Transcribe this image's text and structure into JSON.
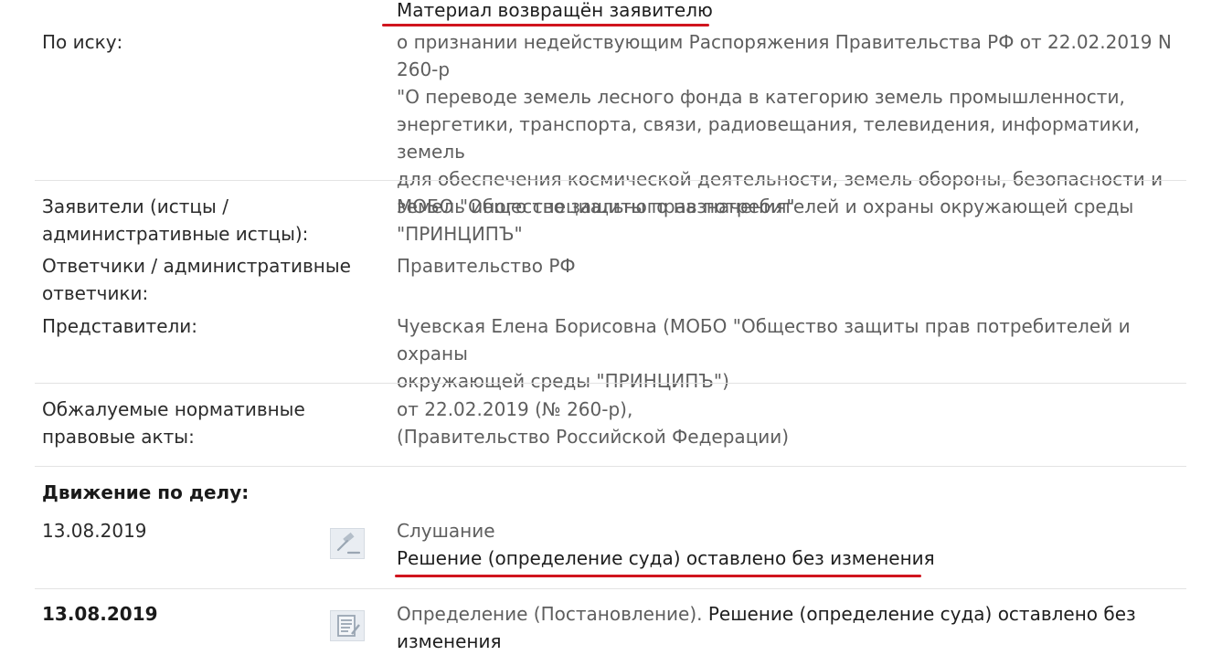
{
  "top": {
    "status_value": "Материал возвращён заявителю"
  },
  "claim": {
    "label": "По иску:",
    "lines": [
      "о признании недействующим Распоряжения Правительства РФ от 22.02.2019 N 260-р",
      "\"О переводе земель лесного фонда в категорию земель промышленности,",
      "энергетики, транспорта, связи, радиовещания, телевидения, информатики, земель",
      "для обеспечения космической деятельности, земель обороны, безопасности и",
      "земель иного специального назначения\""
    ]
  },
  "parties": {
    "applicants_label_lines": [
      "Заявители (истцы /",
      "административные истцы):"
    ],
    "applicants_value_lines": [
      "МОБО \"Общество защиты прав потребителей и охраны окружающей среды",
      "\"ПРИНЦИПЪ\""
    ],
    "respondents_label_lines": [
      "Ответчики / административные",
      "ответчики:"
    ],
    "respondents_value": "Правительство РФ",
    "representatives_label": "Представители:",
    "representatives_value_lines": [
      "Чуевская Елена Борисовна  (МОБО \"Общество защиты прав потребителей и охраны",
      "окружающей среды \"ПРИНЦИПЪ\")"
    ]
  },
  "acts": {
    "label_lines": [
      "Обжалуемые нормативные",
      "правовые акты:"
    ],
    "value_lines": [
      "от 22.02.2019  (№ 260-р),",
      "(Правительство Российской Федерации)"
    ]
  },
  "movement": {
    "heading": "Движение по делу:",
    "events": [
      {
        "date": "13.08.2019",
        "icon": "gavel-icon",
        "type": "Слушание",
        "result": "Решение (определение суда) оставлено без изменения"
      },
      {
        "date": "13.08.2019",
        "icon": "document-icon",
        "type": "Определение (Постановление).",
        "result_line1": "Решение (определение суда) оставлено без",
        "result_line2": "изменения"
      }
    ]
  },
  "colors": {
    "underline": "#d0151e",
    "value_text": "#5e5e5e",
    "label_text": "#2b2b2b",
    "icon_bg": "#e9edf2",
    "icon_stroke": "#9aa6b3"
  }
}
